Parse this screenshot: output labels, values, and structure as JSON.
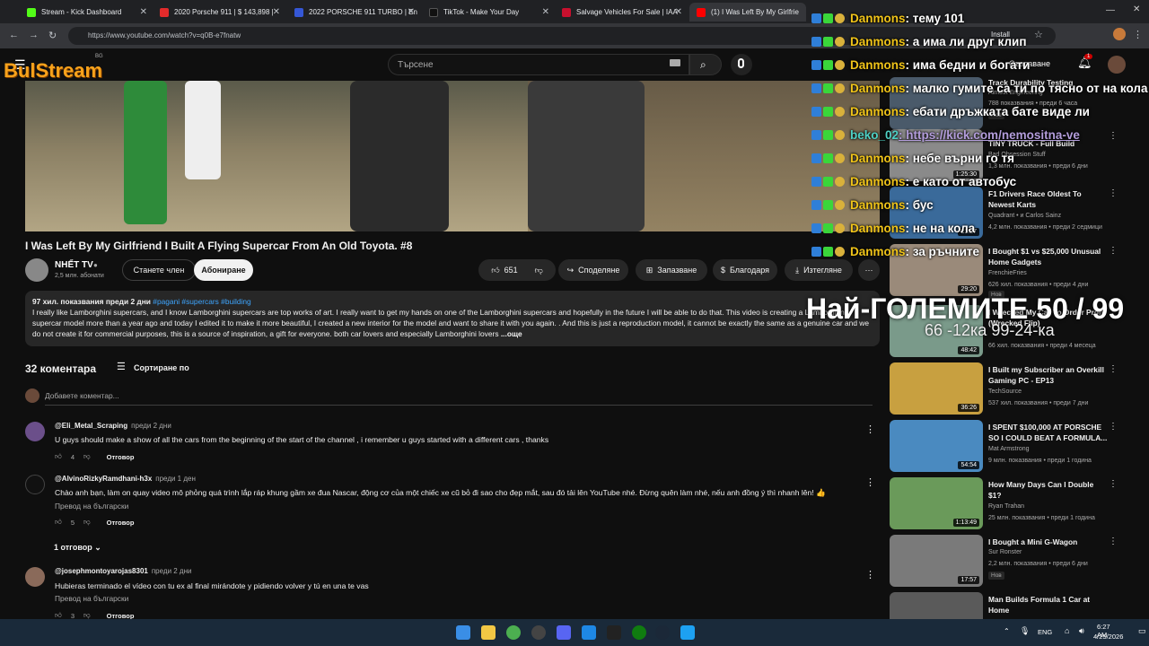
{
  "browser": {
    "tabs": [
      {
        "title": "Stream - Kick Dashboard",
        "color": "#53fc18"
      },
      {
        "title": "2020 Porsche 911 | $ 143,898 |",
        "color": "#e32b2b"
      },
      {
        "title": "2022 PORSCHE 911 TURBO | En",
        "color": "#3557d6"
      },
      {
        "title": "TikTok - Make Your Day",
        "color": "#222222"
      },
      {
        "title": "Salvage Vehicles For Sale | IAA",
        "color": "#c8102e"
      },
      {
        "title": "(1) I Was Left By My Girlfrie",
        "color": "#ff0000"
      }
    ],
    "url": "https://www.youtube.com/watch?v=q0B-e7fnatw",
    "install_label": "Install"
  },
  "youtube": {
    "search_placeholder": "Търсене",
    "logo_region": "BG",
    "notif_count": "1",
    "create_label": "Създаване"
  },
  "stream_logo": "BulStream",
  "video": {
    "title": "I Was Left By My Girlfriend I Built A Flying Supercar From An Old Toyota. #8",
    "channel": "NHẾT TV",
    "subs": "2,5 млн. абонати",
    "join_label": "Станете член",
    "subscribe_label": "Абониране",
    "likes": "651",
    "share_label": "Споделяне",
    "save_label": "Запазване",
    "thanks_label": "Благодаря",
    "download_label": "Изтегляне"
  },
  "description": {
    "meta": "97 хил. показвания  преди 2 дни",
    "tags": "#pagani #supercars #building",
    "text": "I really like Lamborghini supercars, and I know Lamborghini  supercars are top works of art.  I really want to get my hands on one of the Lamborghini  supercars and hopefully in the future I will be able to do that.  This video is creating a Lamborghini  supercar model more than a year ago and today I edited it to make it more beautiful, I created a new interior for the model and want to share it with you again.  .  And this is just a reproduction model, it cannot be exactly the same as a genuine car and we do not create it for commercial purposes, this is a source of inspiration, a gift for everyone.  both car lovers and especially Lamborghini  lovers",
    "more": "...още"
  },
  "comments": {
    "count_label": "32 коментара",
    "sort_label": "Сортиране по",
    "add_placeholder": "Добавете коментар...",
    "items": [
      {
        "author": "@Eli_Metal_Scraping",
        "time": "преди 2 дни",
        "text": "U guys should make a show of all the cars from the beginning of the start of the channel , i remember u guys started with a different cars , thanks",
        "likes": "4",
        "reply": "Отговор",
        "translate": "",
        "avatar": "#6b4f8a"
      },
      {
        "author": "@AlvinoRizkyRamdhani-h3x",
        "time": "преди 1 ден",
        "text": "Chào anh bạn, làm on quay video mô phỏng quá trình lắp ráp khung gầm xe đua Nascar, động cơ của một chiếc xe cũ bỏ đi sao cho đẹp mắt, sau đó tải lên YouTube nhé. Đừng quên làm nhé, nếu anh đồng ý thì nhanh lên! 👍",
        "likes": "5",
        "reply": "Отговор",
        "translate": "Превод на български",
        "avatar": "#111111"
      },
      {
        "author": "@josephmontoyarojas8301",
        "time": "преди 2 дни",
        "text": "Hubieras terminado el vídeo con tu ex al final mirándote y pidiendo volver y tú en una te vas",
        "likes": "3",
        "reply": "Отговор",
        "translate": "Превод на български",
        "avatar": "#8a6a5a"
      }
    ],
    "replies_label": "1 отговор"
  },
  "sidebar": [
    {
      "title": "Track Durability Testing",
      "channel": "Almost Engineering",
      "meta": "788 показвания • преди 6 часа",
      "duration": "",
      "new": "Нов",
      "thumb": "#4a5a6a"
    },
    {
      "title": "TINY TRUCK - Full Build",
      "channel": "Bad Obsession Stuff",
      "meta": "1,3 млн. показвания • преди 6 дни",
      "duration": "1:25:30",
      "new": "",
      "thumb": "#8a8a8a"
    },
    {
      "title": "F1 Drivers Race Oldest To Newest Karts",
      "channel": "Quadrant • и Carlos Sainz",
      "meta": "4,2 млн. показвания • преди 2 седмици",
      "duration": "21:27",
      "new": "",
      "thumb": "#3a6a9a"
    },
    {
      "title": "I Bought $1 vs $25,000 Unusual Home Gadgets",
      "channel": "FrenchieFries",
      "meta": "626 хил. показвания • преди 4 дни",
      "duration": "29:20",
      "new": "Нов",
      "thumb": "#9a8a7a"
    },
    {
      "title": "I Wrecked My Car To Order Profit (Wrecked Flip)",
      "channel": "",
      "meta": "66 хил. показвания • преди 4 месеца",
      "duration": "48:42",
      "new": "",
      "thumb": "#7a9a8a"
    },
    {
      "title": "I Built my Subscriber an Overkill Gaming PC - EP13",
      "channel": "TechSource",
      "meta": "537 хил. показвания • преди 7 дни",
      "duration": "36:26",
      "new": "",
      "thumb": "#c8a040"
    },
    {
      "title": "I SPENT $100,000 AT PORSCHE SO I COULD BEAT A FORMULA...",
      "channel": "Mat Armstrong",
      "meta": "9 млн. показвания • преди 1 година",
      "duration": "54:54",
      "new": "",
      "thumb": "#4a8ac0"
    },
    {
      "title": "How Many Days Can I Double $1?",
      "channel": "Ryan Trahan",
      "meta": "25 млн. показвания • преди 1 година",
      "duration": "1:13:49",
      "new": "",
      "thumb": "#6a9a5a"
    },
    {
      "title": "I Bought a Mini G-Wagon",
      "channel": "Sur Ronster",
      "meta": "2,2 млн. показвания • преди 6 дни",
      "duration": "17:57",
      "new": "Нов",
      "thumb": "#7a7a7a"
    },
    {
      "title": "Man Builds Formula 1 Car at Home",
      "channel": "",
      "meta": "",
      "duration": "",
      "new": "",
      "thumb": "#5a5a5a"
    }
  ],
  "chat": [
    {
      "name": "Danmons",
      "msg": ": тему 101"
    },
    {
      "name": "Danmons",
      "msg": ": а има ли друг клип"
    },
    {
      "name": "Danmons",
      "msg": ": има бедни и богати"
    },
    {
      "name": "Danmons",
      "msg": ": малко гумите са ти по тясно от на кола"
    },
    {
      "name": "Danmons",
      "msg": ": ебати дръжката бате виде ли"
    },
    {
      "name": "beko_02",
      "msg": ": https://kick.com/nemositna-ve"
    },
    {
      "name": "Danmons",
      "msg": ": небе върни го тя"
    },
    {
      "name": "Danmons",
      "msg": ": е като от автобус"
    },
    {
      "name": "Danmons",
      "msg": ": бус"
    },
    {
      "name": "Danmons",
      "msg": ": не на кола"
    },
    {
      "name": "Danmons",
      "msg": ": за ръчните"
    }
  ],
  "overlay": {
    "big": "Най-ГОЛЕМИТЕ 50 / 99",
    "small": "66 -12ка 99-24-ка"
  },
  "taskbar": {
    "lang": "ENG",
    "time": "6:27 AM",
    "date": "4/25/2026"
  }
}
